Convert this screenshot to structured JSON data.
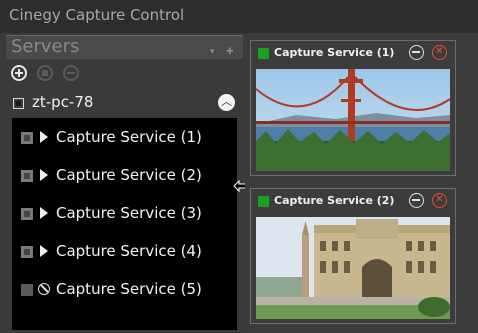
{
  "window": {
    "title": "Cinegy Capture Control"
  },
  "servers_panel": {
    "title": "Servers",
    "header_controls": [
      "▾",
      "✚"
    ],
    "toolbar": {
      "add_icon": "plus-circle-icon",
      "list_icon": "list-circle-icon",
      "remove_icon": "minus-circle-icon"
    },
    "server": {
      "name": "zt-pc-78",
      "expanded": true,
      "collapse_glyph": "︿"
    },
    "services": [
      {
        "label": "Capture Service (1)",
        "checked": true,
        "state_icon": "play-arrow-icon"
      },
      {
        "label": "Capture Service (2)",
        "checked": true,
        "state_icon": "play-arrow-icon"
      },
      {
        "label": "Capture Service (3)",
        "checked": true,
        "state_icon": "play-arrow-icon"
      },
      {
        "label": "Capture Service (4)",
        "checked": true,
        "state_icon": "play-arrow-icon"
      },
      {
        "label": "Capture Service (5)",
        "checked": false,
        "state_icon": "disabled-circle-icon"
      }
    ]
  },
  "monitors": [
    {
      "title": "Capture Service (1)",
      "status_color": "#1aa11a",
      "preview": "golden-gate-bridge",
      "close_glyph": "✕"
    },
    {
      "title": "Capture Service (2)",
      "status_color": "#1aa11a",
      "preview": "historic-building-square",
      "close_glyph": "✕"
    }
  ],
  "colors": {
    "accent_close": "#e8512e",
    "status_running": "#1aa11a",
    "list_background": "#000000"
  }
}
